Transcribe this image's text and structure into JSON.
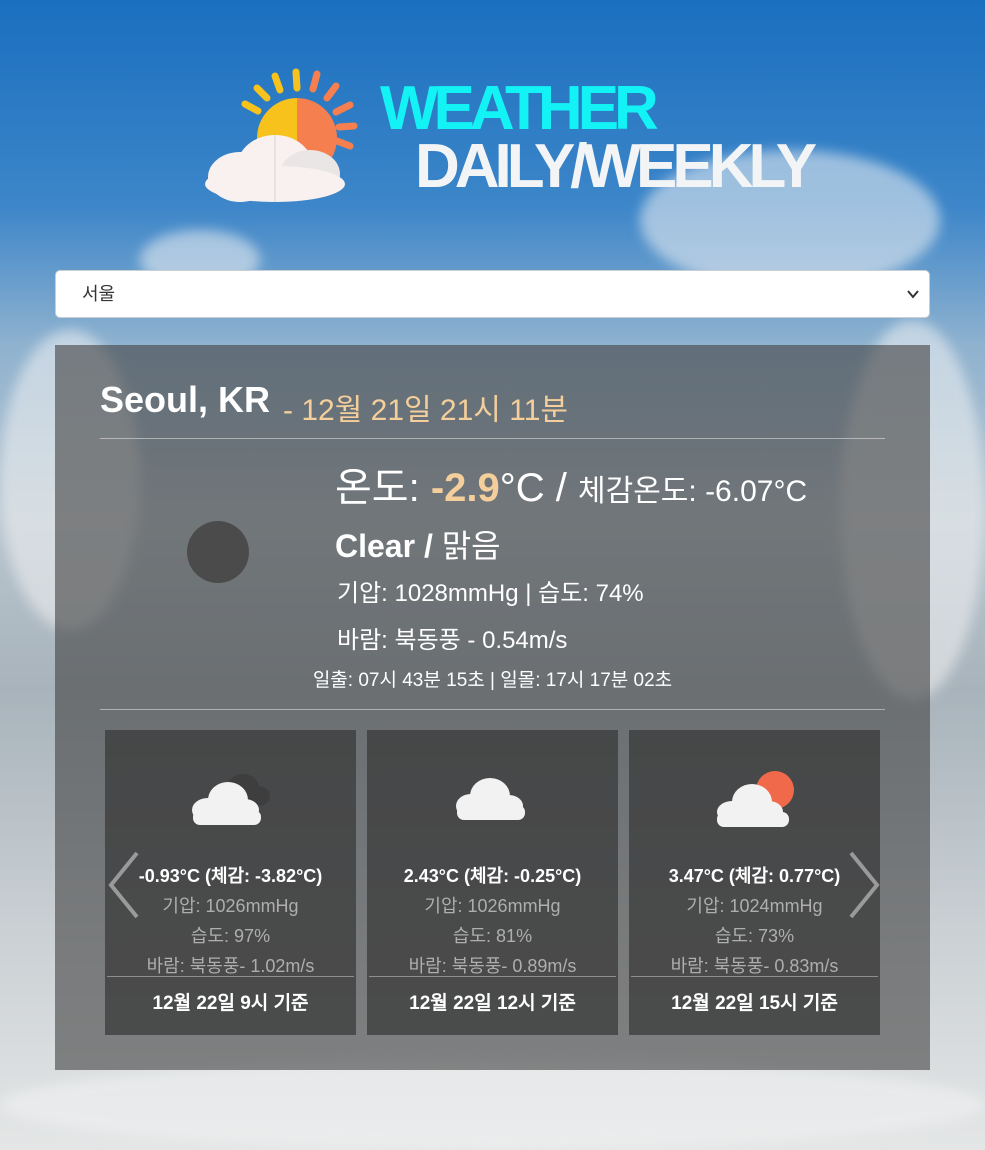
{
  "header": {
    "title_line1": "WEATHER",
    "title_line2": "DAILY/WEEKLY",
    "logo_icon": "sun-cloud-icon"
  },
  "city_select": {
    "selected": "서울"
  },
  "current": {
    "location": "Seoul, KR",
    "datetime": "- 12월 21일 21시 11분",
    "temp_label": "온도: ",
    "temp_value": "-2.9",
    "temp_unit": "°C / ",
    "feels_label": "체감온도: -6.07°C",
    "icon": "clear-night-icon",
    "condition_en": "Clear /",
    "condition_ko": " 맑음",
    "pressure_humidity": "기압: 1028mmHg | 습도: 74%",
    "wind": "바람: 북동풍 - 0.54m/s",
    "sun_times": "일출: 07시 43분 15초 | 일몰: 17시 17분 02초"
  },
  "forecast": [
    {
      "icon": "cloudy-icon",
      "temp": "-0.93°C (체감: -3.82°C)",
      "pressure": "기압: 1026mmHg",
      "humidity": "습도: 97%",
      "wind": "바람: 북동풍- 1.02m/s",
      "time": "12월 22일 9시 기준"
    },
    {
      "icon": "cloud-icon",
      "temp": "2.43°C (체감: -0.25°C)",
      "pressure": "기압: 1026mmHg",
      "humidity": "습도: 81%",
      "wind": "바람: 북동풍- 0.89m/s",
      "time": "12월 22일 12시 기준"
    },
    {
      "icon": "partly-cloudy-icon",
      "temp": "3.47°C (체감: 0.77°C)",
      "pressure": "기압: 1024mmHg",
      "humidity": "습도: 73%",
      "wind": "바람: 북동풍- 0.83m/s",
      "time": "12월 22일 15시 기준"
    }
  ],
  "colors": {
    "title_accent": "#13f3f6",
    "highlight": "#f5cf9b",
    "panel_bg": "rgba(70,70,70,0.62)"
  }
}
